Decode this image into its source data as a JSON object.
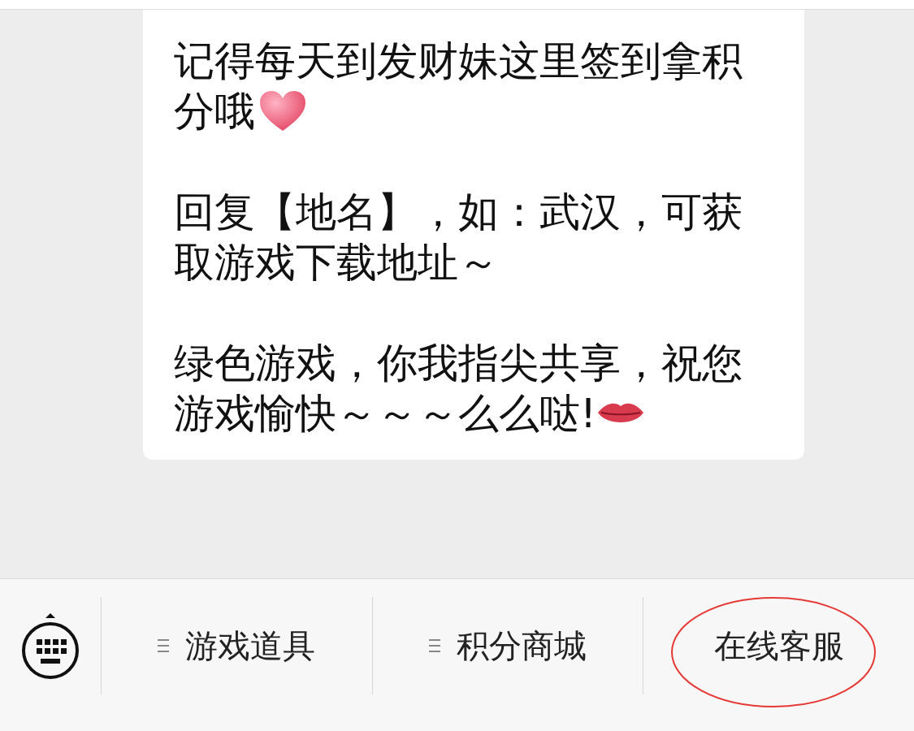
{
  "message": {
    "paragraphs": [
      {
        "kind": "heart",
        "lines": [
          "记得每天到发财妹这里签到拿积",
          "分哦"
        ]
      },
      {
        "kind": "plain",
        "lines": [
          "回复【地名】，如：武汉，可获",
          "取游戏下载地址～"
        ]
      },
      {
        "kind": "lips",
        "lines": [
          "绿色游戏，你我指尖共享，祝您",
          "游戏愉快～～～么么哒!"
        ]
      }
    ]
  },
  "menu_bar": {
    "items": [
      {
        "label": "游戏道具",
        "kind": "submenu",
        "circled": false
      },
      {
        "label": "积分商城",
        "kind": "submenu",
        "circled": false
      },
      {
        "label": "在线客服",
        "kind": "plain",
        "circled": true
      }
    ]
  }
}
